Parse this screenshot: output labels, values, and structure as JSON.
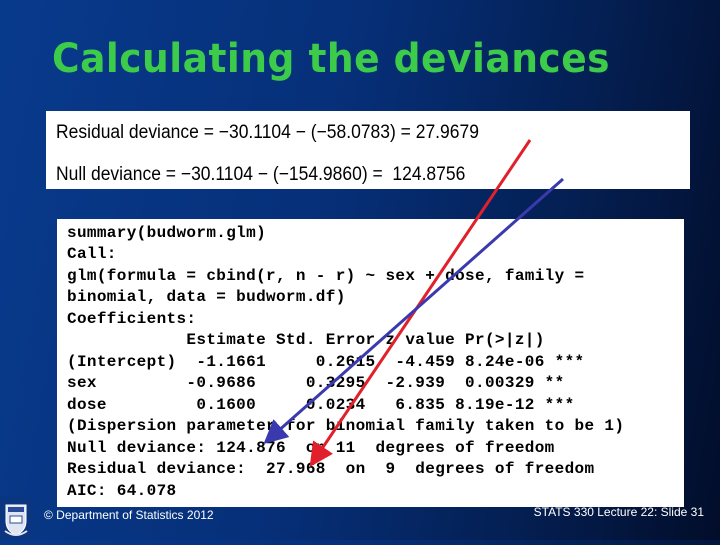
{
  "slide": {
    "title": "Calculating the deviances",
    "deviance_box": {
      "residual": "Residual deviance = −30.1104 − (−58.0783) = 27.9679",
      "null": "Null deviance = −30.1104 − (−154.9860) =  124.8756"
    },
    "code_output": {
      "lines": [
        "summary(budworm.glm)",
        "Call:",
        "glm(formula = cbind(r, n - r) ~ sex + dose, family =",
        "binomial, data = budworm.df)",
        "Coefficients:",
        "            Estimate Std. Error z value Pr(>|z|)",
        "(Intercept)  -1.1661     0.2615  -4.459 8.24e-06 ***",
        "sex         -0.9686     0.3295  -2.939  0.00329 **",
        "dose         0.1600     0.0234   6.835 8.19e-12 ***",
        "(Dispersion parameter for binomial family taken to be 1)",
        "Null deviance: 124.876  on 11  degrees of freedom",
        "Residual deviance:  27.968  on  9  degrees of freedom",
        "AIC: 64.078"
      ]
    },
    "annotations": {
      "red_arrow": "residual deviance 27.9679 -> 27.968",
      "blue_arrow": "null deviance 124.8756 -> 124.876",
      "colors": {
        "red": "#e0202a",
        "blue": "#3a3aae"
      }
    },
    "footer": {
      "left": "© Department of Statistics 2012",
      "right": "STATS 330 Lecture 22: Slide 31"
    },
    "logo_icon": "university-crest-icon",
    "colors": {
      "title": "#3ccc4a",
      "background": "#062f78"
    }
  }
}
